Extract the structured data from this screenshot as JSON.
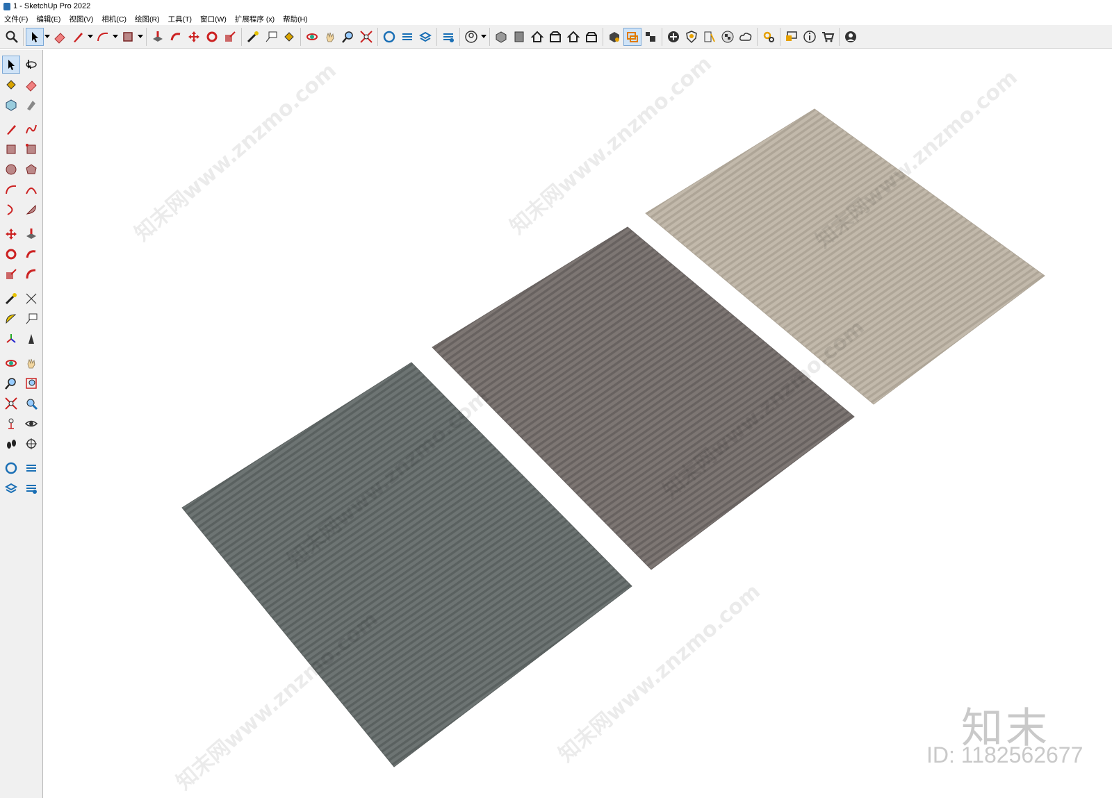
{
  "window": {
    "title": "1 - SketchUp Pro 2022"
  },
  "menu": [
    "文件(F)",
    "编辑(E)",
    "视图(V)",
    "相机(C)",
    "绘图(R)",
    "工具(T)",
    "窗口(W)",
    "扩展程序 (x)",
    "帮助(H)"
  ],
  "watermark": {
    "brand": "知末",
    "id": "ID: 1182562677",
    "repeat_text": "知末网www.znzmo.com"
  },
  "model": {
    "panels": [
      {
        "name": "dark-gray-rug",
        "color": "#6d7473",
        "stripe": "#5a6160"
      },
      {
        "name": "taupe-rug",
        "color": "#7d7673",
        "stripe": "#686260"
      },
      {
        "name": "beige-rug",
        "color": "#c2b9ab",
        "stripe": "#aea597"
      }
    ]
  }
}
